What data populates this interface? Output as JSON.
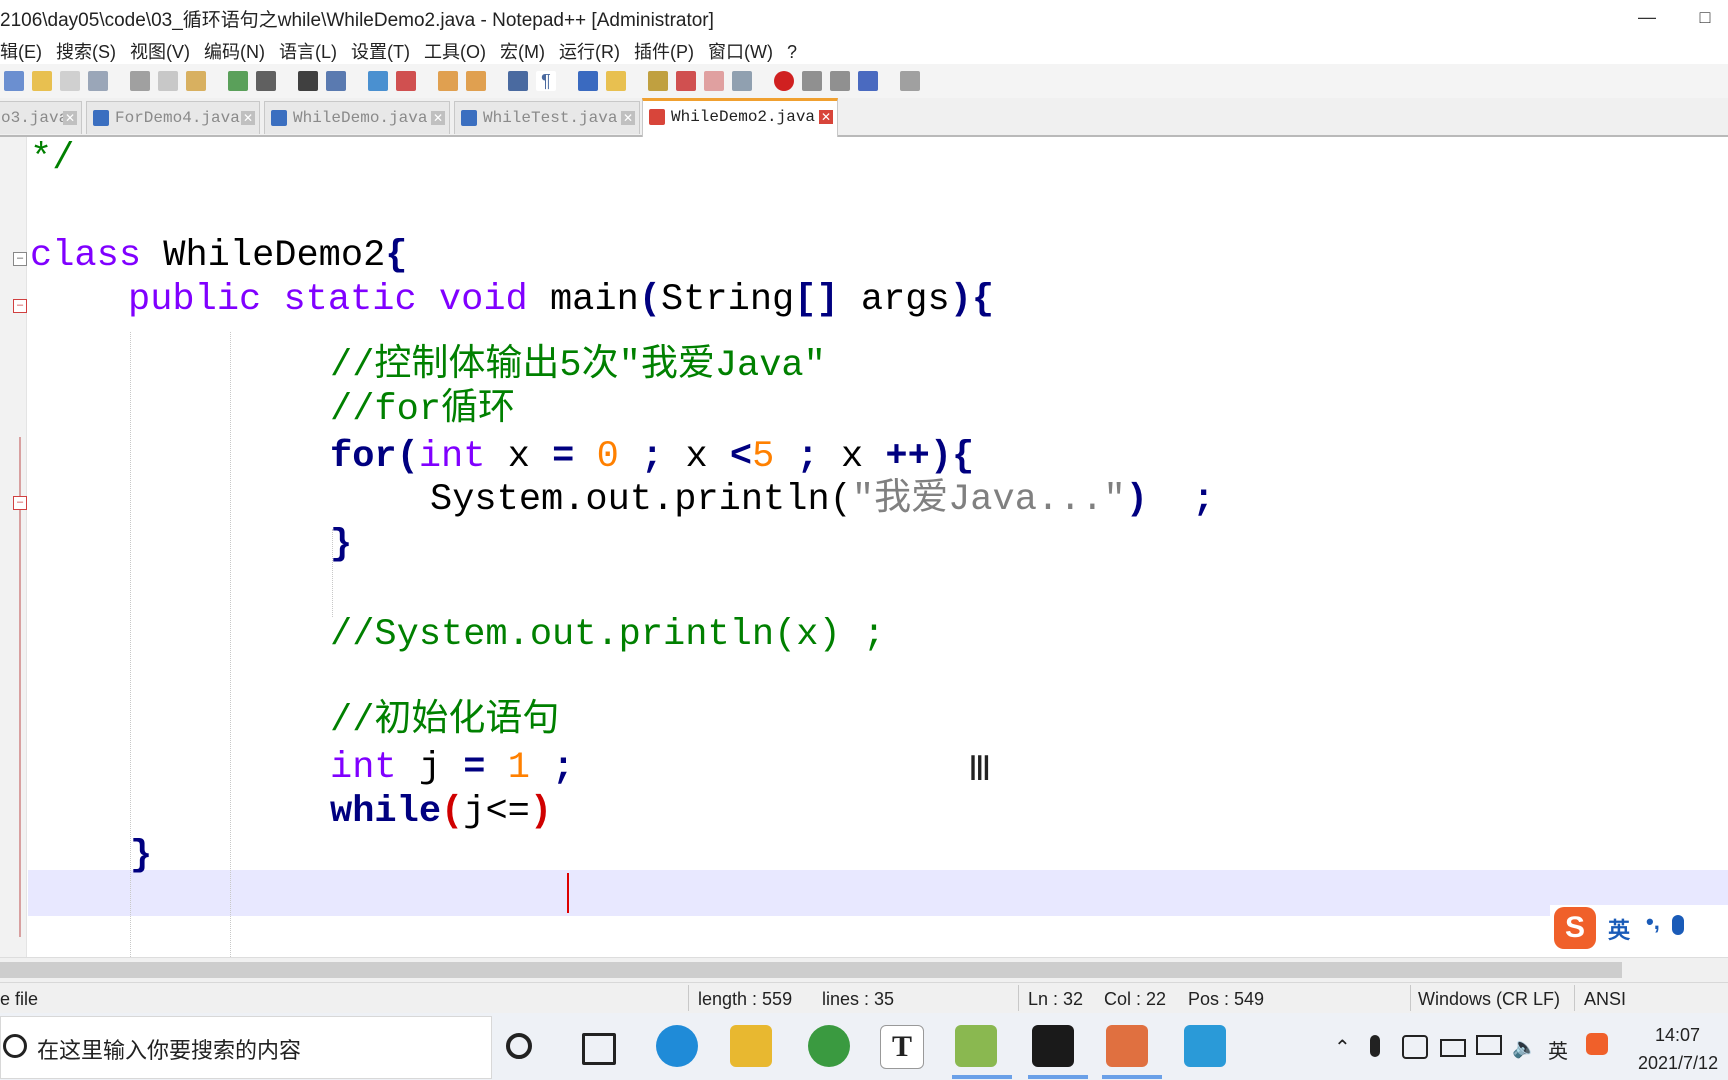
{
  "window": {
    "title": "2106\\day05\\code\\03_循环语句之while\\WhileDemo2.java - Notepad++ [Administrator]"
  },
  "menu": [
    "辑(E)",
    "搜索(S)",
    "视图(V)",
    "编码(N)",
    "语言(L)",
    "设置(T)",
    "工具(O)",
    "宏(M)",
    "运行(R)",
    "插件(P)",
    "窗口(W)",
    "?"
  ],
  "tabs": [
    {
      "label": "o3.java",
      "active": false
    },
    {
      "label": "ForDemo4.java",
      "active": false
    },
    {
      "label": "WhileDemo.java",
      "active": false
    },
    {
      "label": "WhileTest.java",
      "active": false
    },
    {
      "label": "WhileDemo2.java",
      "active": true
    }
  ],
  "code": {
    "l1": "*/",
    "l2_kw": "class",
    "l2_name": "WhileDemo2",
    "l2_brace": "{",
    "l3_public": "public",
    "l3_static": "static",
    "l3_void": "void",
    "l3_main": "main",
    "l3_paren_open": "(",
    "l3_string": "String",
    "l3_brackets": "[]",
    "l3_args": "args",
    "l3_close": "){",
    "c1": "//控制体输出5次\"我爱Java\"",
    "c2": "//for循环",
    "for_kw": "for",
    "for_open": "(",
    "for_int": "int",
    "for_x1": "x",
    "for_eq": "=",
    "for_zero": "0",
    "for_semi1": ";",
    "for_x2": "x",
    "for_lt": "<",
    "for_five": "5",
    "for_semi2": ";",
    "for_x3": "x",
    "for_inc": "++",
    "for_close": "){",
    "println_call": "System.out.println(",
    "println_str": "\"我爱Java...\"",
    "println_end": ")",
    "println_semi": ";",
    "for_end": "}",
    "c3": "//System.out.println(x) ;",
    "c4": "//初始化语句",
    "int_kw": "int",
    "j_var": "j",
    "j_eq": "=",
    "j_one": "1",
    "j_semi": ";",
    "while_kw": "while",
    "while_open": "(",
    "while_cond": "j<=",
    "while_close": ")",
    "method_end": "}"
  },
  "ime": {
    "logo": "S",
    "lang": "英",
    "punct": "•,"
  },
  "status": {
    "left": "e file",
    "length": "length : 559",
    "lines": "lines : 35",
    "ln": "Ln : 32",
    "col": "Col : 22",
    "pos": "Pos : 549",
    "eol": "Windows (CR LF)",
    "encoding": "ANSI"
  },
  "taskbar": {
    "search_placeholder": "在这里输入你要搜索的内容",
    "time": "14:07",
    "date": "2021/7/12",
    "tray_lang": "英"
  },
  "colors": {
    "keyword": "#8000ff",
    "keyword_bold": "#000080",
    "number": "#ff8000",
    "string": "#808080",
    "comment": "#008000",
    "current_line": "#e8e8ff",
    "active_tab_accent": "#f0a030"
  }
}
